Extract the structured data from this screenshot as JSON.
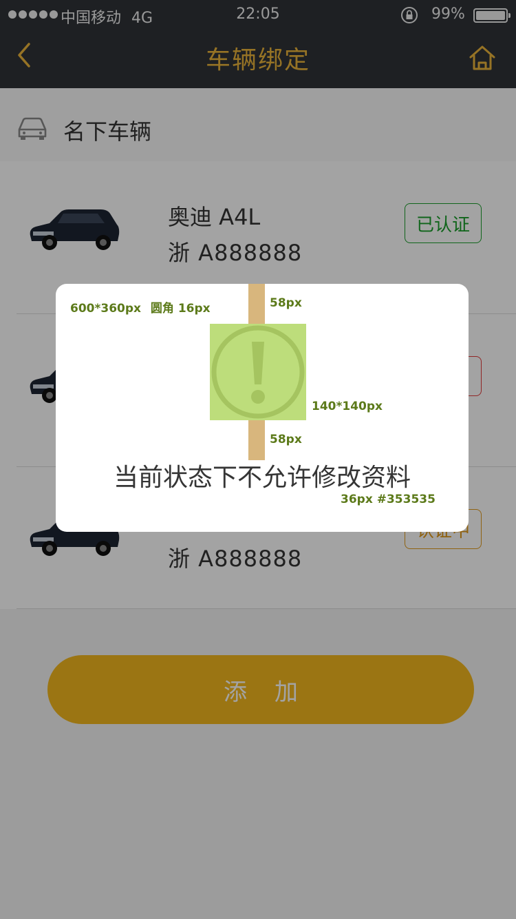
{
  "status_bar": {
    "carrier": "中国移动",
    "network": "4G",
    "time": "22:05",
    "battery_percent": "99%",
    "battery_level": 0.99
  },
  "nav": {
    "title": "车辆绑定",
    "back_icon": "chevron-left-icon",
    "home_icon": "home-icon"
  },
  "section": {
    "title": "名下车辆",
    "icon": "car-outline-icon"
  },
  "vehicles": [
    {
      "model": "奥迪 A4L",
      "plate": "浙 A888888",
      "status": "已认证",
      "status_color": "#1a9e2b"
    },
    {
      "model": "",
      "plate": "",
      "status": "",
      "status_color": "#e23a3a"
    },
    {
      "model": "",
      "plate": "浙 A888888",
      "status": "认证中",
      "status_color": "#e09a1c"
    }
  ],
  "add_button": {
    "label": "添加"
  },
  "modal": {
    "message": "当前状态下不允许修改资料",
    "icon": "warning-icon",
    "annotations": {
      "size": "600*360px",
      "radius": "圆角 16px",
      "top_gap": "58px",
      "icon_size": "140*140px",
      "bottom_gap": "58px",
      "font_spec": "36px #353535"
    }
  },
  "colors": {
    "nav_bg": "#2f3338",
    "accent": "#ebb53b",
    "button": "#f2b71f",
    "text": "#353535",
    "icon_box": "#bddd7b",
    "spacer": "#d8b67d"
  }
}
